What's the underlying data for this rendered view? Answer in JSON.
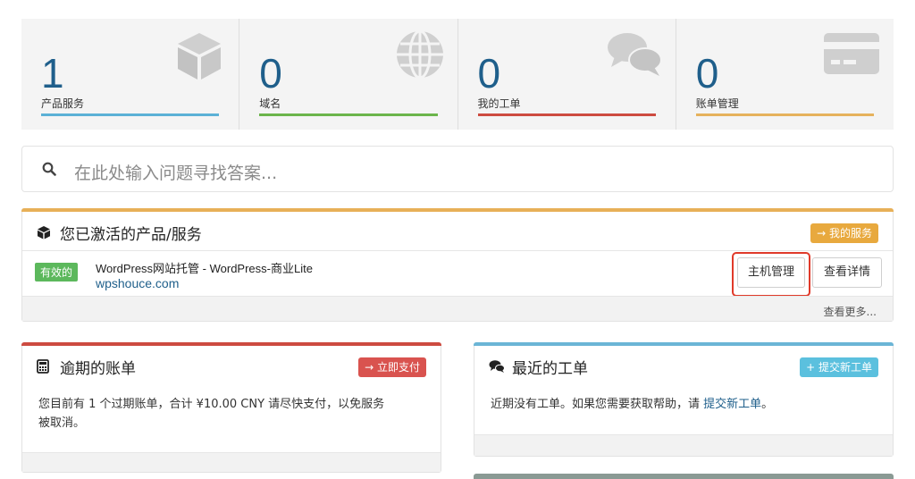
{
  "stats": [
    {
      "number": "1",
      "label": "产品服务",
      "color": "#5bb1d6",
      "icon": "cube-icon"
    },
    {
      "number": "0",
      "label": "域名",
      "color": "#6bb54b",
      "icon": "globe-icon"
    },
    {
      "number": "0",
      "label": "我的工单",
      "color": "#cd4b40",
      "icon": "comments-icon"
    },
    {
      "number": "0",
      "label": "账单管理",
      "color": "#e6b25c",
      "icon": "credit-card-icon"
    }
  ],
  "search": {
    "placeholder": "在此处输入问题寻找答案..."
  },
  "services_panel": {
    "title": "您已激活的产品/服务",
    "accent": "#e8b058",
    "header_button": "→ 我的服务",
    "status": "有效的",
    "product_name": "WordPress网站托管 - WordPress-商业Lite",
    "domain": "wpshouce.com",
    "manage_button": "主机管理",
    "details_button": "查看详情",
    "more_link": "查看更多..."
  },
  "invoices_panel": {
    "title": "逾期的账单",
    "accent": "#cd4b40",
    "header_button": "→ 立即支付",
    "text_line1": "您目前有 1 个过期账单，合计 ¥10.00 CNY 请尽快支付，以免服务",
    "text_line2": "被取消。"
  },
  "tickets_panel": {
    "title": "最近的工单",
    "accent": "#6bb5d6",
    "header_button": "+ 提交新工单",
    "text": "近期没有工单。如果您需要获取帮助，请 ",
    "link": "提交新工单",
    "text_end": "。"
  }
}
